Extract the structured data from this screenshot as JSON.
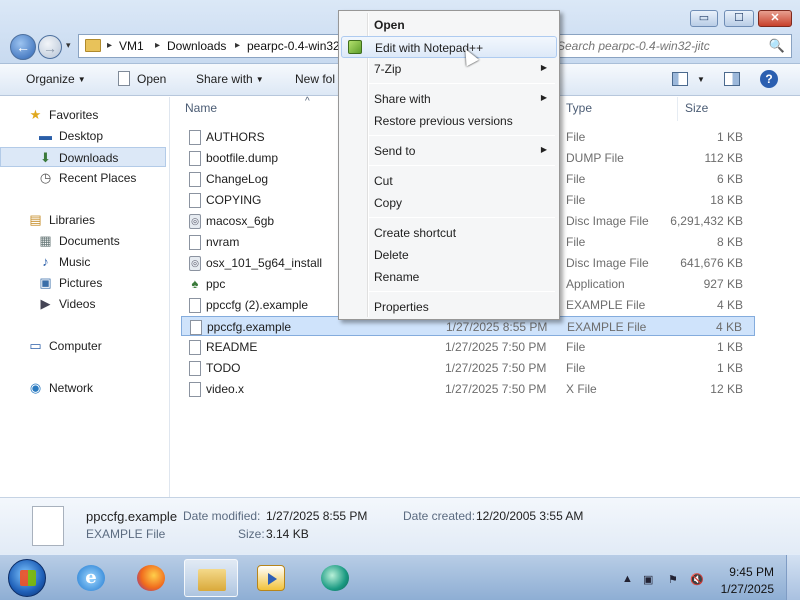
{
  "window": {
    "minimize_glyph": "▭",
    "maximize_glyph": "☐",
    "close_glyph": "✕"
  },
  "address": {
    "breadcrumbs": [
      "VM1",
      "Downloads",
      "pearpc-0.4-win32"
    ],
    "separator": "▸",
    "back_glyph": "←",
    "forward_glyph": "→",
    "history_glyph": "▾"
  },
  "search": {
    "placeholder": "Search pearpc-0.4-win32-jitc",
    "icon": "🔍"
  },
  "toolbar": {
    "organize": "Organize",
    "open": "Open",
    "share_with": "Share with",
    "new_folder": "New fol",
    "dropdown_glyph": "▼",
    "help": "?"
  },
  "nav": {
    "items": [
      {
        "label": "Favorites",
        "icon": "★"
      },
      {
        "label": "Desktop",
        "icon": "▬"
      },
      {
        "label": "Downloads",
        "icon": "⬇"
      },
      {
        "label": "Recent Places",
        "icon": "◷"
      },
      {
        "label": "Libraries",
        "icon": "▤"
      },
      {
        "label": "Documents",
        "icon": "▦"
      },
      {
        "label": "Music",
        "icon": "♪"
      },
      {
        "label": "Pictures",
        "icon": "▣"
      },
      {
        "label": "Videos",
        "icon": "▶"
      },
      {
        "label": "Computer",
        "icon": "▭"
      },
      {
        "label": "Network",
        "icon": "◉"
      }
    ]
  },
  "columns": {
    "name": "Name",
    "type": "Type",
    "size": "Size",
    "sort_glyph": "^"
  },
  "files": [
    {
      "name": "AUTHORS",
      "date": "",
      "type": "File",
      "size": "1 KB",
      "icon": ""
    },
    {
      "name": "bootfile.dump",
      "date": "",
      "type": "DUMP File",
      "size": "112 KB",
      "icon": ""
    },
    {
      "name": "ChangeLog",
      "date": "",
      "type": "File",
      "size": "6 KB",
      "icon": ""
    },
    {
      "name": "COPYING",
      "date": "",
      "type": "File",
      "size": "18 KB",
      "icon": ""
    },
    {
      "name": "macosx_6gb",
      "date": "",
      "type": "Disc Image File",
      "size": "6,291,432 KB",
      "icon": "◎"
    },
    {
      "name": "nvram",
      "date": "",
      "type": "File",
      "size": "8 KB",
      "icon": ""
    },
    {
      "name": "osx_101_5g64_install",
      "date": "",
      "type": "Disc Image File",
      "size": "641,676 KB",
      "icon": "◎"
    },
    {
      "name": "ppc",
      "date": "",
      "type": "Application",
      "size": "927 KB",
      "icon": "♠"
    },
    {
      "name": "ppccfg (2).example",
      "date": "",
      "type": "EXAMPLE File",
      "size": "4 KB",
      "icon": ""
    },
    {
      "name": "ppccfg.example",
      "date": "1/27/2025 8:55 PM",
      "type": "EXAMPLE File",
      "size": "4 KB",
      "icon": ""
    },
    {
      "name": "README",
      "date": "1/27/2025 7:50 PM",
      "type": "File",
      "size": "1 KB",
      "icon": ""
    },
    {
      "name": "TODO",
      "date": "1/27/2025 7:50 PM",
      "type": "File",
      "size": "1 KB",
      "icon": ""
    },
    {
      "name": "video.x",
      "date": "1/27/2025 7:50 PM",
      "type": "X File",
      "size": "12 KB",
      "icon": ""
    }
  ],
  "selected_file_index": 9,
  "details": {
    "name": "ppccfg.example",
    "type": "EXAMPLE File",
    "date_modified_label": "Date modified:",
    "date_modified": "1/27/2025 8:55 PM",
    "size_label": "Size:",
    "size": "3.14 KB",
    "date_created_label": "Date created:",
    "date_created": "12/20/2005 3:55 AM"
  },
  "context_menu": {
    "items": [
      {
        "label": "Open",
        "bold": true,
        "submenu": false
      },
      {
        "label": "Edit with Notepad++",
        "bold": false,
        "submenu": false,
        "hover": true
      },
      {
        "label": "7-Zip",
        "bold": false,
        "submenu": true
      },
      {
        "label": "Share with",
        "bold": false,
        "submenu": true
      },
      {
        "label": "Restore previous versions",
        "bold": false,
        "submenu": false
      },
      {
        "label": "Send to",
        "bold": false,
        "submenu": true
      },
      {
        "label": "Cut",
        "bold": false,
        "submenu": false
      },
      {
        "label": "Copy",
        "bold": false,
        "submenu": false
      },
      {
        "label": "Create shortcut",
        "bold": false,
        "submenu": false
      },
      {
        "label": "Delete",
        "bold": false,
        "submenu": false
      },
      {
        "label": "Rename",
        "bold": false,
        "submenu": false
      },
      {
        "label": "Properties",
        "bold": false,
        "submenu": false
      }
    ],
    "submenu_glyph": "▶"
  },
  "taskbar": {
    "apps": [
      "Internet Explorer",
      "Firefox",
      "Windows Explorer",
      "Windows Media Player",
      "VM app"
    ],
    "ie_letter": "e",
    "tray_up": "▲",
    "tray_icons": [
      "▣",
      "⚑",
      "🔇"
    ],
    "time": "9:45 PM",
    "date": "1/27/2025"
  },
  "colors": {
    "selection": "#cfe3fb",
    "accent": "#2b5fb0",
    "title_bar": "#c8daf0"
  }
}
